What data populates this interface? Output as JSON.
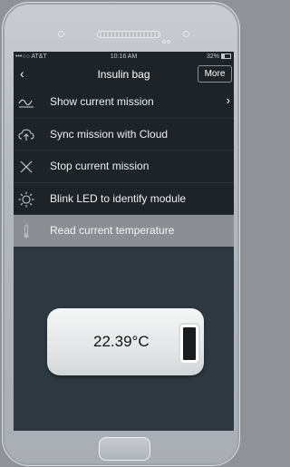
{
  "status_bar": {
    "carrier": "•••○○ AT&T",
    "time": "10:16 AM",
    "battery": "32%"
  },
  "nav": {
    "back_icon": "chevron-left-icon",
    "title": "Insulin bag",
    "more_label": "More"
  },
  "menu": {
    "items": [
      {
        "label": "Show current mission",
        "icon": "graph-icon",
        "has_chevron": true
      },
      {
        "label": "Sync mission with Cloud",
        "icon": "cloud-upload-icon"
      },
      {
        "label": "Stop current mission",
        "icon": "x-icon"
      },
      {
        "label": "Blink LED to identify module",
        "icon": "sun-led-icon"
      },
      {
        "label": "Read current temperature",
        "icon": "thermometer-icon",
        "selected": true
      }
    ]
  },
  "sensor": {
    "temperature": "22.39°C"
  },
  "colors": {
    "screen_bg": "#2d3841",
    "row_bg": "#1e2328",
    "selected_row": "#8b8f93"
  }
}
